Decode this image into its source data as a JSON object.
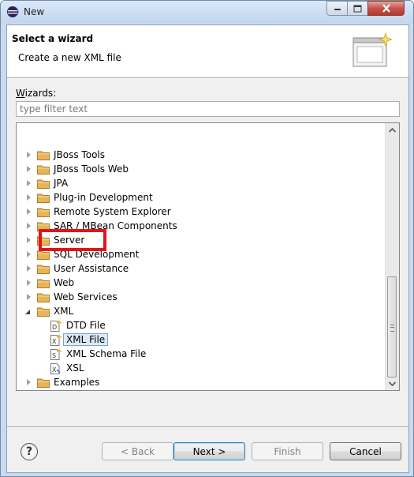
{
  "window": {
    "title": "New"
  },
  "header": {
    "title": "Select a wizard",
    "description": "Create a new XML file"
  },
  "filter": {
    "label_prefix": "",
    "label_accel": "W",
    "label_rest": "izards:",
    "placeholder": "type filter text",
    "value": ""
  },
  "tree": {
    "items": [
      {
        "label": "JBoss Tools",
        "type": "folder",
        "expanded": false,
        "level": 0
      },
      {
        "label": "JBoss Tools Web",
        "type": "folder",
        "expanded": false,
        "level": 0
      },
      {
        "label": "JPA",
        "type": "folder",
        "expanded": false,
        "level": 0
      },
      {
        "label": "Plug-in Development",
        "type": "folder",
        "expanded": false,
        "level": 0
      },
      {
        "label": "Remote System Explorer",
        "type": "folder",
        "expanded": false,
        "level": 0
      },
      {
        "label": "SAR / MBean Components",
        "type": "folder",
        "expanded": false,
        "level": 0
      },
      {
        "label": "Server",
        "type": "folder",
        "expanded": false,
        "level": 0
      },
      {
        "label": "SQL Development",
        "type": "folder",
        "expanded": false,
        "level": 0
      },
      {
        "label": "User Assistance",
        "type": "folder",
        "expanded": false,
        "level": 0
      },
      {
        "label": "Web",
        "type": "folder",
        "expanded": false,
        "level": 0
      },
      {
        "label": "Web Services",
        "type": "folder",
        "expanded": false,
        "level": 0
      },
      {
        "label": "XML",
        "type": "folder",
        "expanded": true,
        "level": 0
      },
      {
        "label": "DTD File",
        "type": "file",
        "level": 1
      },
      {
        "label": "XML File",
        "type": "file",
        "level": 1,
        "selected": true
      },
      {
        "label": "XML Schema File",
        "type": "file",
        "level": 1
      },
      {
        "label": "XSL",
        "type": "file",
        "level": 1
      },
      {
        "label": "Examples",
        "type": "folder",
        "expanded": false,
        "level": 0
      }
    ]
  },
  "buttons": {
    "back": "< Back",
    "next": "Next >",
    "finish": "Finish",
    "cancel": "Cancel",
    "help": "?"
  },
  "colors": {
    "highlight": "#e0141c",
    "folder": "#e8b45a",
    "selection": "#dceaf8"
  }
}
